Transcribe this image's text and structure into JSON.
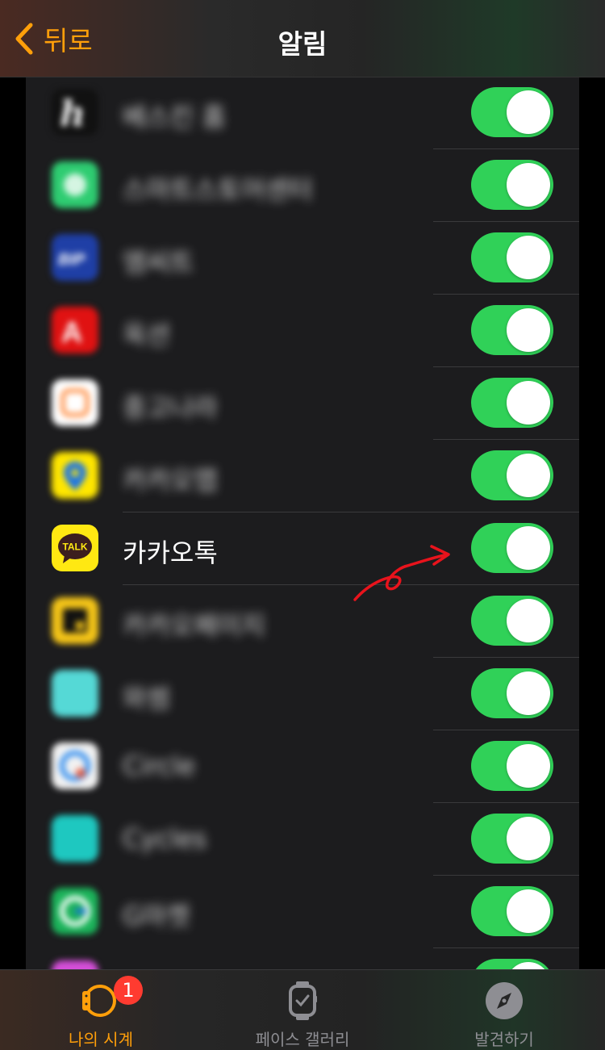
{
  "nav": {
    "back_label": "뒤로",
    "title": "알림"
  },
  "apps": [
    {
      "name": "베스킨 홈",
      "enabled": true,
      "blurred": true,
      "icon": "script-logo-icon",
      "icon_color": "#111111"
    },
    {
      "name": "스마트스토어센터",
      "enabled": true,
      "blurred": true,
      "icon": "smartstore-icon",
      "icon_color": "#2ecc71"
    },
    {
      "name": "엠씨트",
      "enabled": true,
      "blurred": true,
      "icon": "blue-brand-icon",
      "icon_color": "#1f3fa6"
    },
    {
      "name": "옥션",
      "enabled": true,
      "blurred": true,
      "icon": "auction-icon",
      "icon_color": "#e01212"
    },
    {
      "name": "중고나라",
      "enabled": true,
      "blurred": true,
      "icon": "junggonara-icon",
      "icon_color": "#ffffff"
    },
    {
      "name": "카카오맵",
      "enabled": true,
      "blurred": true,
      "icon": "map-pin-icon",
      "icon_color": "#ffe600"
    },
    {
      "name": "카카오톡",
      "enabled": true,
      "blurred": false,
      "icon": "kakaotalk-icon",
      "icon_color": "#ffe812",
      "icon_text": "TALK"
    },
    {
      "name": "카카오페이지",
      "enabled": true,
      "blurred": true,
      "icon": "kakaopage-icon",
      "icon_color": "#f5c518"
    },
    {
      "name": "와썸",
      "enabled": true,
      "blurred": true,
      "icon": "teal-app-icon",
      "icon_color": "#55d9d6"
    },
    {
      "name": "Circle",
      "enabled": true,
      "blurred": true,
      "icon": "circle-app-icon",
      "icon_color": "#f2f2f2"
    },
    {
      "name": "Cycles",
      "enabled": true,
      "blurred": true,
      "icon": "cycles-app-icon",
      "icon_color": "#1ec8c0"
    },
    {
      "name": "G마켓",
      "enabled": true,
      "blurred": true,
      "icon": "gmarket-icon",
      "icon_color": "#1bb35a"
    },
    {
      "name": "",
      "enabled": true,
      "blurred": true,
      "icon": "purple-app-icon",
      "icon_color": "#d44fd8"
    }
  ],
  "colors": {
    "accent": "#ff9f0a",
    "toggle_on": "#30d158",
    "badge": "#ff3b30",
    "annotation": "#e8131c"
  },
  "tabs": [
    {
      "label": "나의 시계",
      "icon": "watch-icon",
      "active": true,
      "badge": "1"
    },
    {
      "label": "페이스 갤러리",
      "icon": "watch-face-icon",
      "active": false
    },
    {
      "label": "발견하기",
      "icon": "compass-icon",
      "active": false
    }
  ]
}
